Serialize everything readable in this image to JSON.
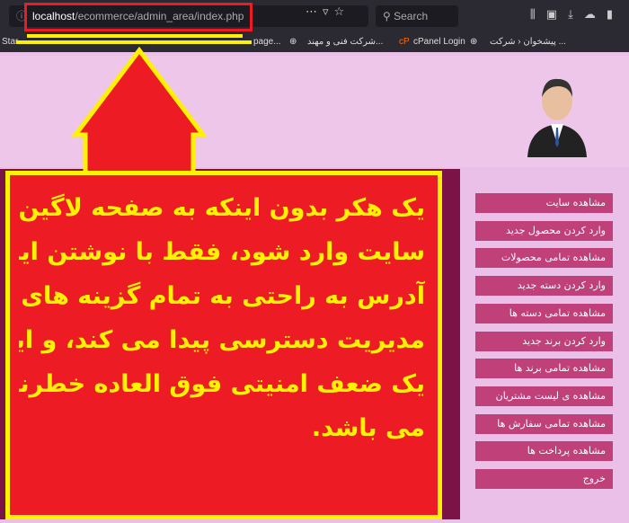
{
  "browser": {
    "url_host": "localhost",
    "url_path": "/ecommerce/admin_area/index.php",
    "search_placeholder": "Search",
    "bookmarks": [
      "Star",
      "page...",
      "شرکت فنی و مهند...",
      "cPanel Login",
      "پیشخوان ‹ شرکت ..."
    ]
  },
  "sidebar": {
    "items": [
      {
        "label": "مشاهده سایت"
      },
      {
        "label": "وارد کردن محصول جدید"
      },
      {
        "label": "مشاهده تمامی محصولات"
      },
      {
        "label": "وارد کردن دسته جدید"
      },
      {
        "label": "مشاهده تمامی دسته ها"
      },
      {
        "label": "وارد کردن برند جدید"
      },
      {
        "label": "مشاهده تمامی برند ها"
      },
      {
        "label": "مشاهده ی لیست مشتریان"
      },
      {
        "label": "مشاهده تمامی سفارش ها"
      },
      {
        "label": "مشاهده پرداخت ها"
      },
      {
        "label": "خروج"
      }
    ]
  },
  "annotation": {
    "lines": [
      "یک هکر بدون اینکه به صفحه لاگین",
      "سایت وارد شود، فقط با نوشتن این",
      "آدرس به راحتی به تمام گزینه های",
      "مدیریت دسترسی پیدا می کند، و این",
      "یک ضعف امنیتی فوق العاده خطرناک",
      "می باشد."
    ],
    "box_color": "#ed1c24",
    "text_color": "#fff200"
  },
  "colors": {
    "nav_button": "#c0417a",
    "main_bg": "#7b1347",
    "page_bg": "#ebc0e8"
  }
}
